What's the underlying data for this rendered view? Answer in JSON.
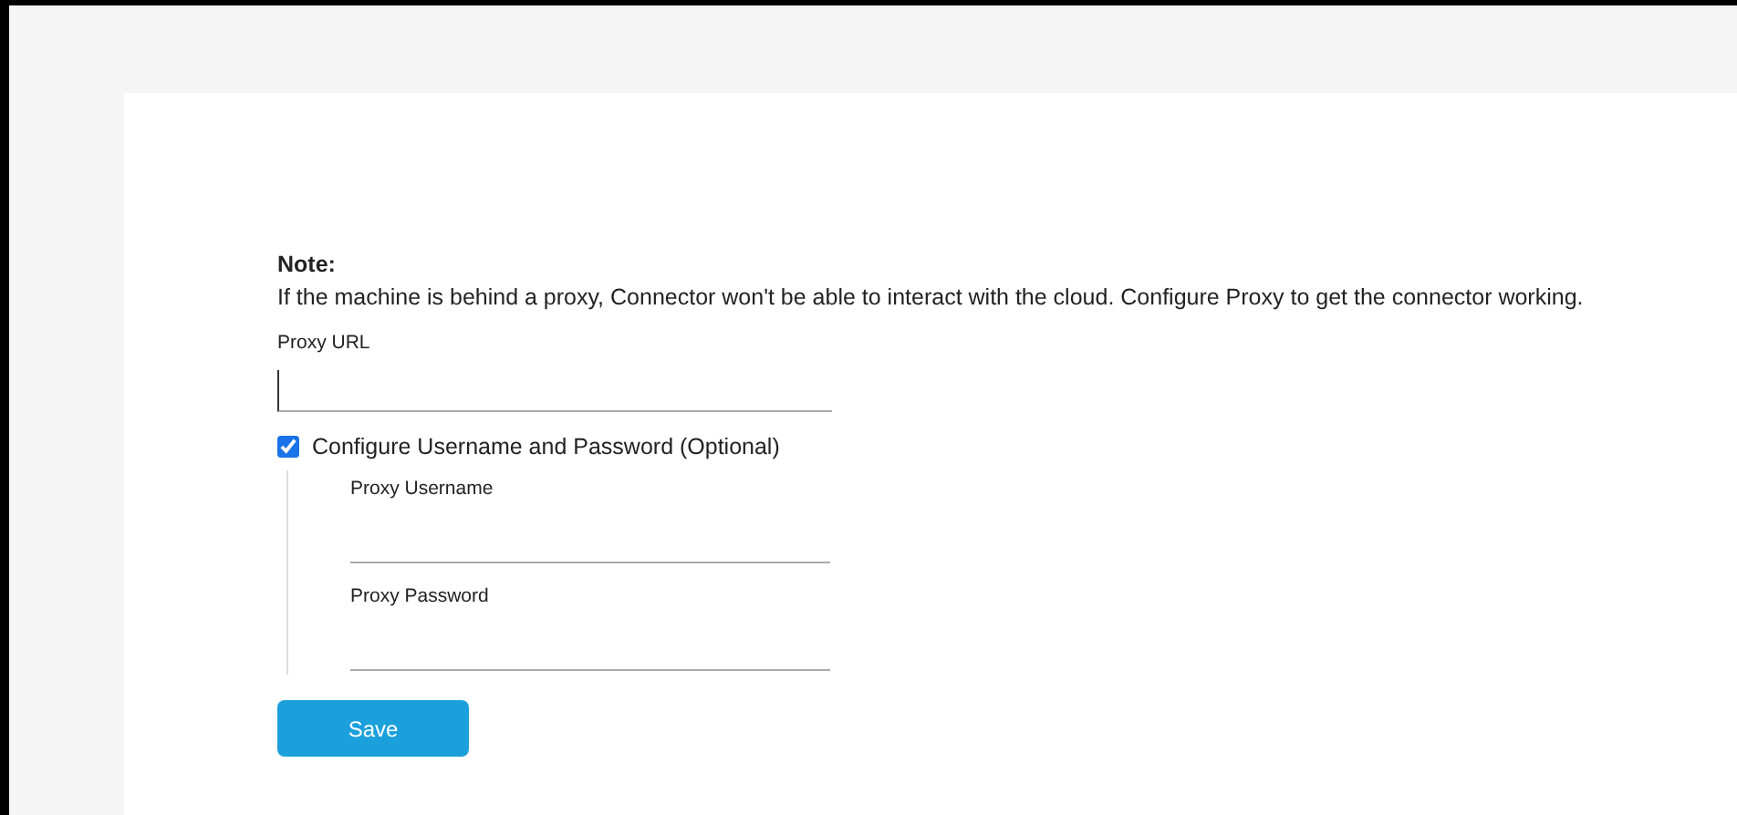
{
  "note": {
    "title": "Note:",
    "text": "If the machine is behind a proxy, Connector won't be able to interact with the cloud. Configure Proxy to get the connector working."
  },
  "proxy_url": {
    "label": "Proxy URL",
    "focused": true
  },
  "credentials_checkbox": {
    "label": "Configure Username and Password (Optional)",
    "checked": true
  },
  "credential_fields": [
    {
      "label": "Proxy Username"
    },
    {
      "label": "Proxy Password"
    }
  ],
  "buttons": [
    {
      "label": "Save"
    }
  ]
}
